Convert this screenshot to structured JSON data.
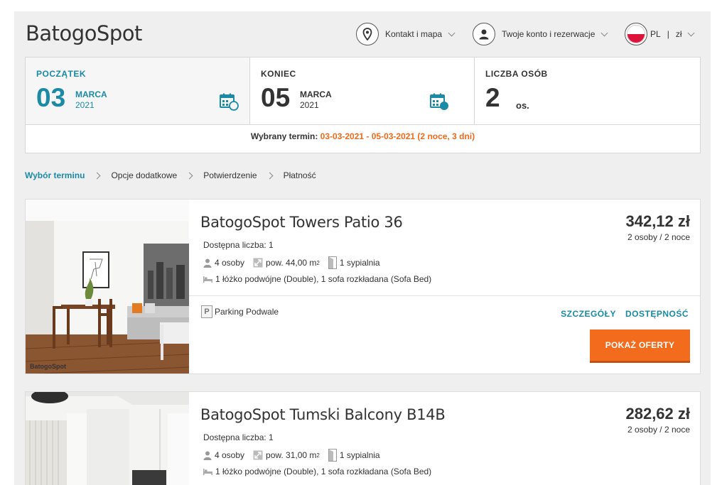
{
  "header": {
    "logo": "BatogoSpot",
    "contact_label": "Kontakt i mapa",
    "account_label": "Twoje konto i rezerwacje",
    "lang": "PL",
    "lang_sep": "|",
    "currency": "zł"
  },
  "dates": {
    "start": {
      "label": "POCZĄTEK",
      "day": "03",
      "month": "MARCA",
      "year": "2021"
    },
    "end": {
      "label": "KONIEC",
      "day": "05",
      "month": "MARCA",
      "year": "2021"
    },
    "guests": {
      "label": "LICZBA OSÓB",
      "count": "2",
      "unit": "os."
    },
    "term_label": "Wybrany termin:",
    "term_value": "03-03-2021 - 05-03-2021 (2 noce, 3 dni)"
  },
  "breadcrumb": [
    "Wybór terminu",
    "Opcje dodatkowe",
    "Potwierdzenie",
    "Płatność"
  ],
  "listings": [
    {
      "title": "BatogoSpot Towers Patio 36",
      "price": "342,12 zł",
      "price_for": "2 osoby / 2 noce",
      "availability": "Dostępna liczba: 1",
      "persons": "4 osoby",
      "area": "pow. 44,00 m",
      "area_sup": "2",
      "bedrooms": "1 sypialnia",
      "beds": "1 łóżko podwójne (Double), 1 sofa rozkładana (Sofa Bed)",
      "parking": "Parking Podwale",
      "details_label": "SZCZEGÓŁY",
      "availability_label": "DOSTĘPNOŚĆ",
      "offers_label": "POKAŻ OFERTY",
      "watermark": "BatogoSpot"
    },
    {
      "title": "BatogoSpot Tumski Balcony B14B",
      "price": "282,62 zł",
      "price_for": "2 osoby / 2 noce",
      "availability": "Dostępna liczba: 1",
      "persons": "4 osoby",
      "area": "pow. 31,00 m",
      "area_sup": "2",
      "bedrooms": "1 sypialnia",
      "beds": "1 łóżko podwójne (Double), 1 sofa rozkładana (Sofa Bed)"
    }
  ],
  "colors": {
    "accent": "#1a8aa6",
    "orange": "#f36b1c",
    "highlight": "#f06a1a"
  },
  "icons": [
    "location-pin-icon",
    "user-icon",
    "poland-flag-icon",
    "calendar-icon",
    "person-icon",
    "area-icon",
    "door-icon",
    "bed-icon",
    "parking-icon"
  ]
}
